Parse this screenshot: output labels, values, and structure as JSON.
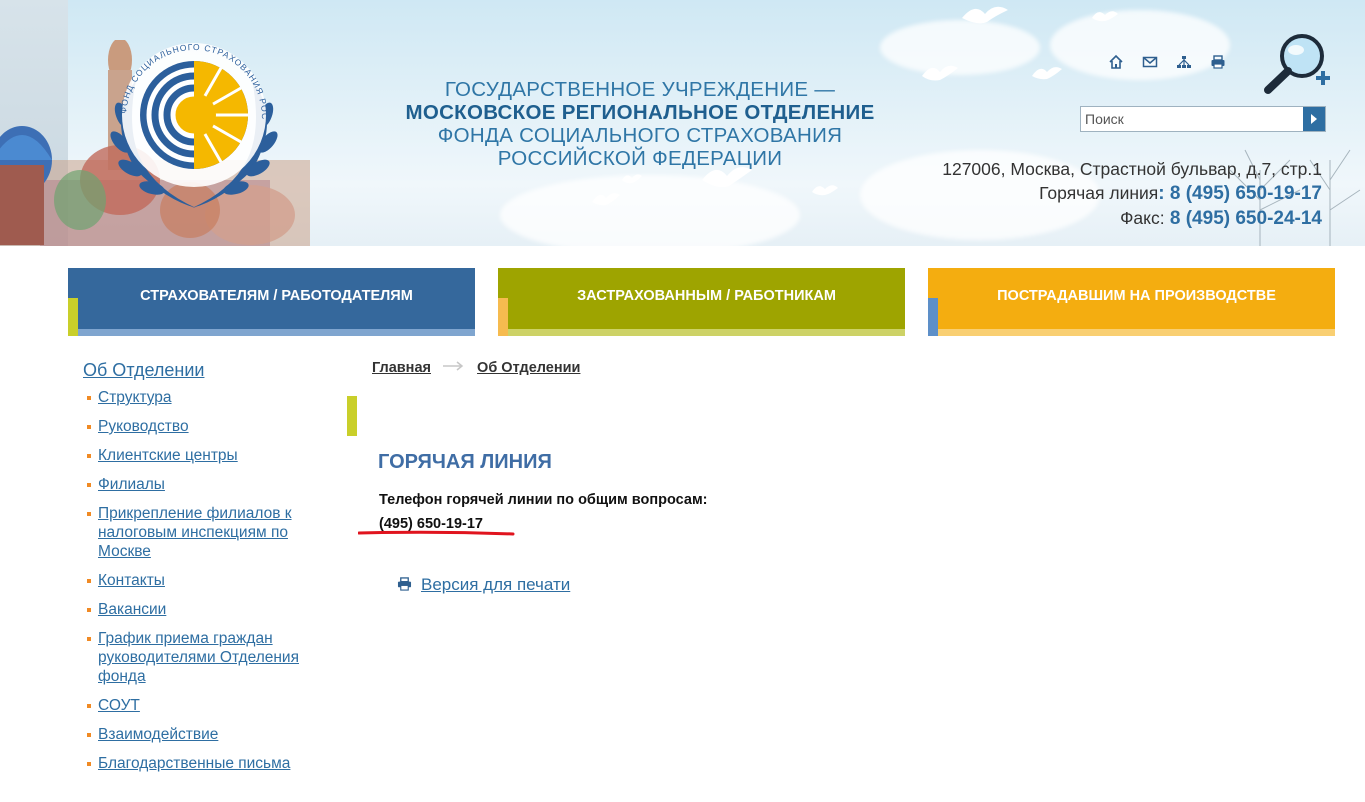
{
  "header": {
    "org_line1": "ГОСУДАРСТВЕННОЕ УЧРЕЖДЕНИЕ —",
    "org_line2": "МОСКОВСКОЕ РЕГИОНАЛЬНОЕ ОТДЕЛЕНИЕ",
    "org_line3": "ФОНДА СОЦИАЛЬНОГО СТРАХОВАНИЯ",
    "org_line4": "РОССИЙСКОЙ ФЕДЕРАЦИИ",
    "emblem_text": "ФОНД СОЦИАЛЬНОГО СТРАХОВАНИЯ РОССИЙСКОЙ ФЕДЕРАЦИИ",
    "icons": [
      "home-icon",
      "mail-icon",
      "sitemap-icon",
      "print-icon"
    ],
    "search_placeholder": "Поиск",
    "address": "127006, Москва, Страстной бульвар, д.7, стр.1",
    "hotline_label": "Горячая линия",
    "hotline_phone": ": 8 (495) 650-19-17",
    "fax_label": "Факс:",
    "fax_phone": " 8 (495) 650-24-14"
  },
  "categories": [
    {
      "label": "СТРАХОВАТЕЛЯМ / РАБОТОДАТЕЛЯМ",
      "color": "#35689c"
    },
    {
      "label": "ЗАСТРАХОВАННЫМ / РАБОТНИКАМ",
      "color": "#9ea400"
    },
    {
      "label": "ПОСТРАДАВШИМ НА ПРОИЗВОДСТВЕ",
      "color": "#f4ad10"
    }
  ],
  "sidebar": {
    "title": "Об Отделении",
    "items": [
      {
        "label": "Структура"
      },
      {
        "label": "Руководство"
      },
      {
        "label": "Клиентские центры"
      },
      {
        "label": "Филиалы"
      },
      {
        "label": "Прикрепление филиалов к налоговым инспекциям по Москве"
      },
      {
        "label": "Контакты"
      },
      {
        "label": "Вакансии"
      },
      {
        "label": "График приема граждан руководителями Отделения фонда"
      },
      {
        "label": "СОУТ"
      },
      {
        "label": "Взаимодействие"
      },
      {
        "label": "Благодарственные письма"
      }
    ]
  },
  "breadcrumb": {
    "home": "Главная",
    "current": "Об Отделении"
  },
  "main": {
    "title": "ГОРЯЧАЯ ЛИНИЯ",
    "hotline_label": "Телефон горячей линии по общим вопросам:",
    "hotline_phone": "(495) 650-19-17",
    "print_label": "Версия для печати"
  },
  "colors": {
    "brand_blue": "#2e6ea2",
    "accent_orange": "#f08a24",
    "underline_red": "#e0141e"
  }
}
